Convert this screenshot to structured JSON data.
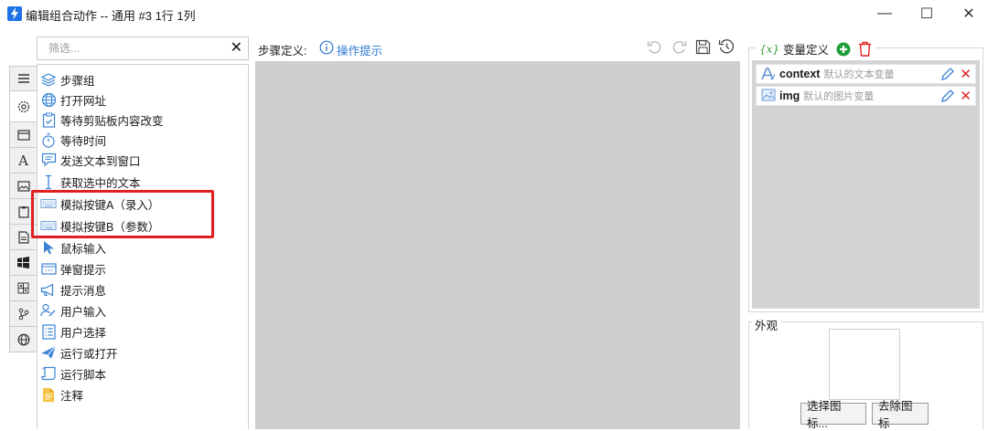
{
  "window": {
    "title": "编辑组合动作 -- 通用 #3 1行 1列",
    "minimize": "—",
    "maximize": "☐",
    "close": "✕"
  },
  "filter": {
    "placeholder": "筛选...",
    "value": "",
    "clear": "✕"
  },
  "left_tabs": [
    "list-icon",
    "gear-icon",
    "window-icon",
    "text-icon",
    "image-icon",
    "clipboard-icon",
    "document-icon",
    "windows-icon",
    "grid-icon",
    "branch-icon",
    "globe-icon"
  ],
  "actions": [
    {
      "label": "步骤组",
      "icon": "stack-icon"
    },
    {
      "label": "打开网址",
      "icon": "globe-icon"
    },
    {
      "label": "等待剪贴板内容改变",
      "icon": "clipboard-check-icon"
    },
    {
      "label": "等待时间",
      "icon": "stopwatch-icon"
    },
    {
      "label": "发送文本到窗口",
      "icon": "message-icon"
    },
    {
      "label": "获取选中的文本",
      "icon": "text-cursor-icon"
    },
    {
      "label": "模拟按键A（录入）",
      "icon": "keyboard-icon"
    },
    {
      "label": "模拟按键B（参数）",
      "icon": "keyboard-icon"
    },
    {
      "label": "鼠标输入",
      "icon": "mouse-pointer-icon"
    },
    {
      "label": "弹窗提示",
      "icon": "popup-icon"
    },
    {
      "label": "提示消息",
      "icon": "megaphone-icon"
    },
    {
      "label": "用户输入",
      "icon": "user-edit-icon"
    },
    {
      "label": "用户选择",
      "icon": "list-check-icon"
    },
    {
      "label": "运行或打开",
      "icon": "paper-plane-icon"
    },
    {
      "label": "运行脚本",
      "icon": "script-icon"
    },
    {
      "label": "注释",
      "icon": "note-icon"
    }
  ],
  "steps": {
    "label": "步骤定义:",
    "hint": "操作提示",
    "toolbar": [
      "undo-icon",
      "redo-icon",
      "save-icon",
      "history-icon"
    ]
  },
  "variables": {
    "header": "变量定义",
    "curly": "{x}",
    "items": [
      {
        "name": "context",
        "desc": "默认的文本变量",
        "icon": "text-var-icon"
      },
      {
        "name": "img",
        "desc": "默认的图片变量",
        "icon": "image-var-icon"
      }
    ]
  },
  "appearance": {
    "label": "外观",
    "choose_button": "选择图标...",
    "remove_button": "去除图标"
  },
  "colors": {
    "accent_blue": "#2f7ad6",
    "highlight_red": "#e02020",
    "canvas_gray": "#cfcfcf",
    "add_green": "#1e9e3a"
  }
}
